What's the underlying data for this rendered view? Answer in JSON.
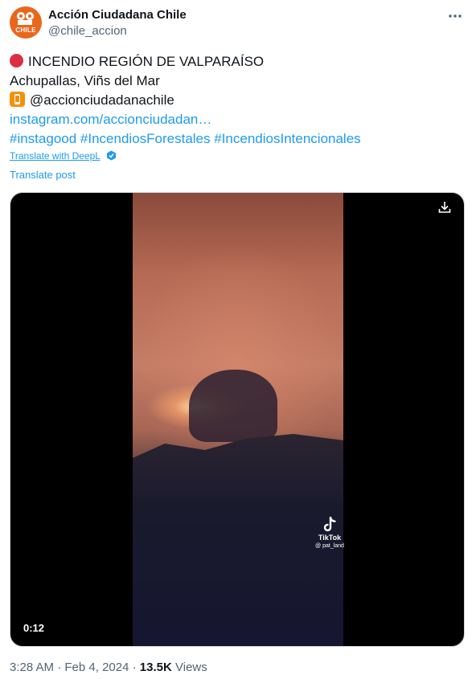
{
  "header": {
    "display_name": "Acción Ciudadana Chile",
    "handle": "@chile_accion",
    "avatar_text": "CHILE",
    "more_icon": "ellipsis-horizontal-icon"
  },
  "body": {
    "line1_emoji": "red-circle-emoji",
    "line1_text": "INCENDIO REGIÓN DE VALPARAÍSO",
    "line2_text": "Achupallas, Viñs del Mar",
    "line3_emoji": "mobile-phone-emoji",
    "line3_text": "@accionciudadanachile",
    "link_text": "instagram.com/accionciudadan…",
    "hashtag1": "#instagood",
    "hashtag2": "#IncendiosForestales",
    "hashtag3": "#IncendiosIntencionales"
  },
  "translate": {
    "deepl_label": "Translate with DeepL",
    "post_label": "Translate post"
  },
  "media": {
    "duration": "0:12",
    "watermark_name": "TikTok",
    "watermark_user": "@ pat_land",
    "download_icon": "download-icon"
  },
  "meta": {
    "time": "3:28 AM",
    "separator": "·",
    "date": "Feb 4, 2024",
    "views_count": "13.5K",
    "views_label": "Views"
  },
  "colors": {
    "link": "#1d9bf0",
    "secondary_text": "#536471",
    "avatar_bg": "#e8671c"
  }
}
